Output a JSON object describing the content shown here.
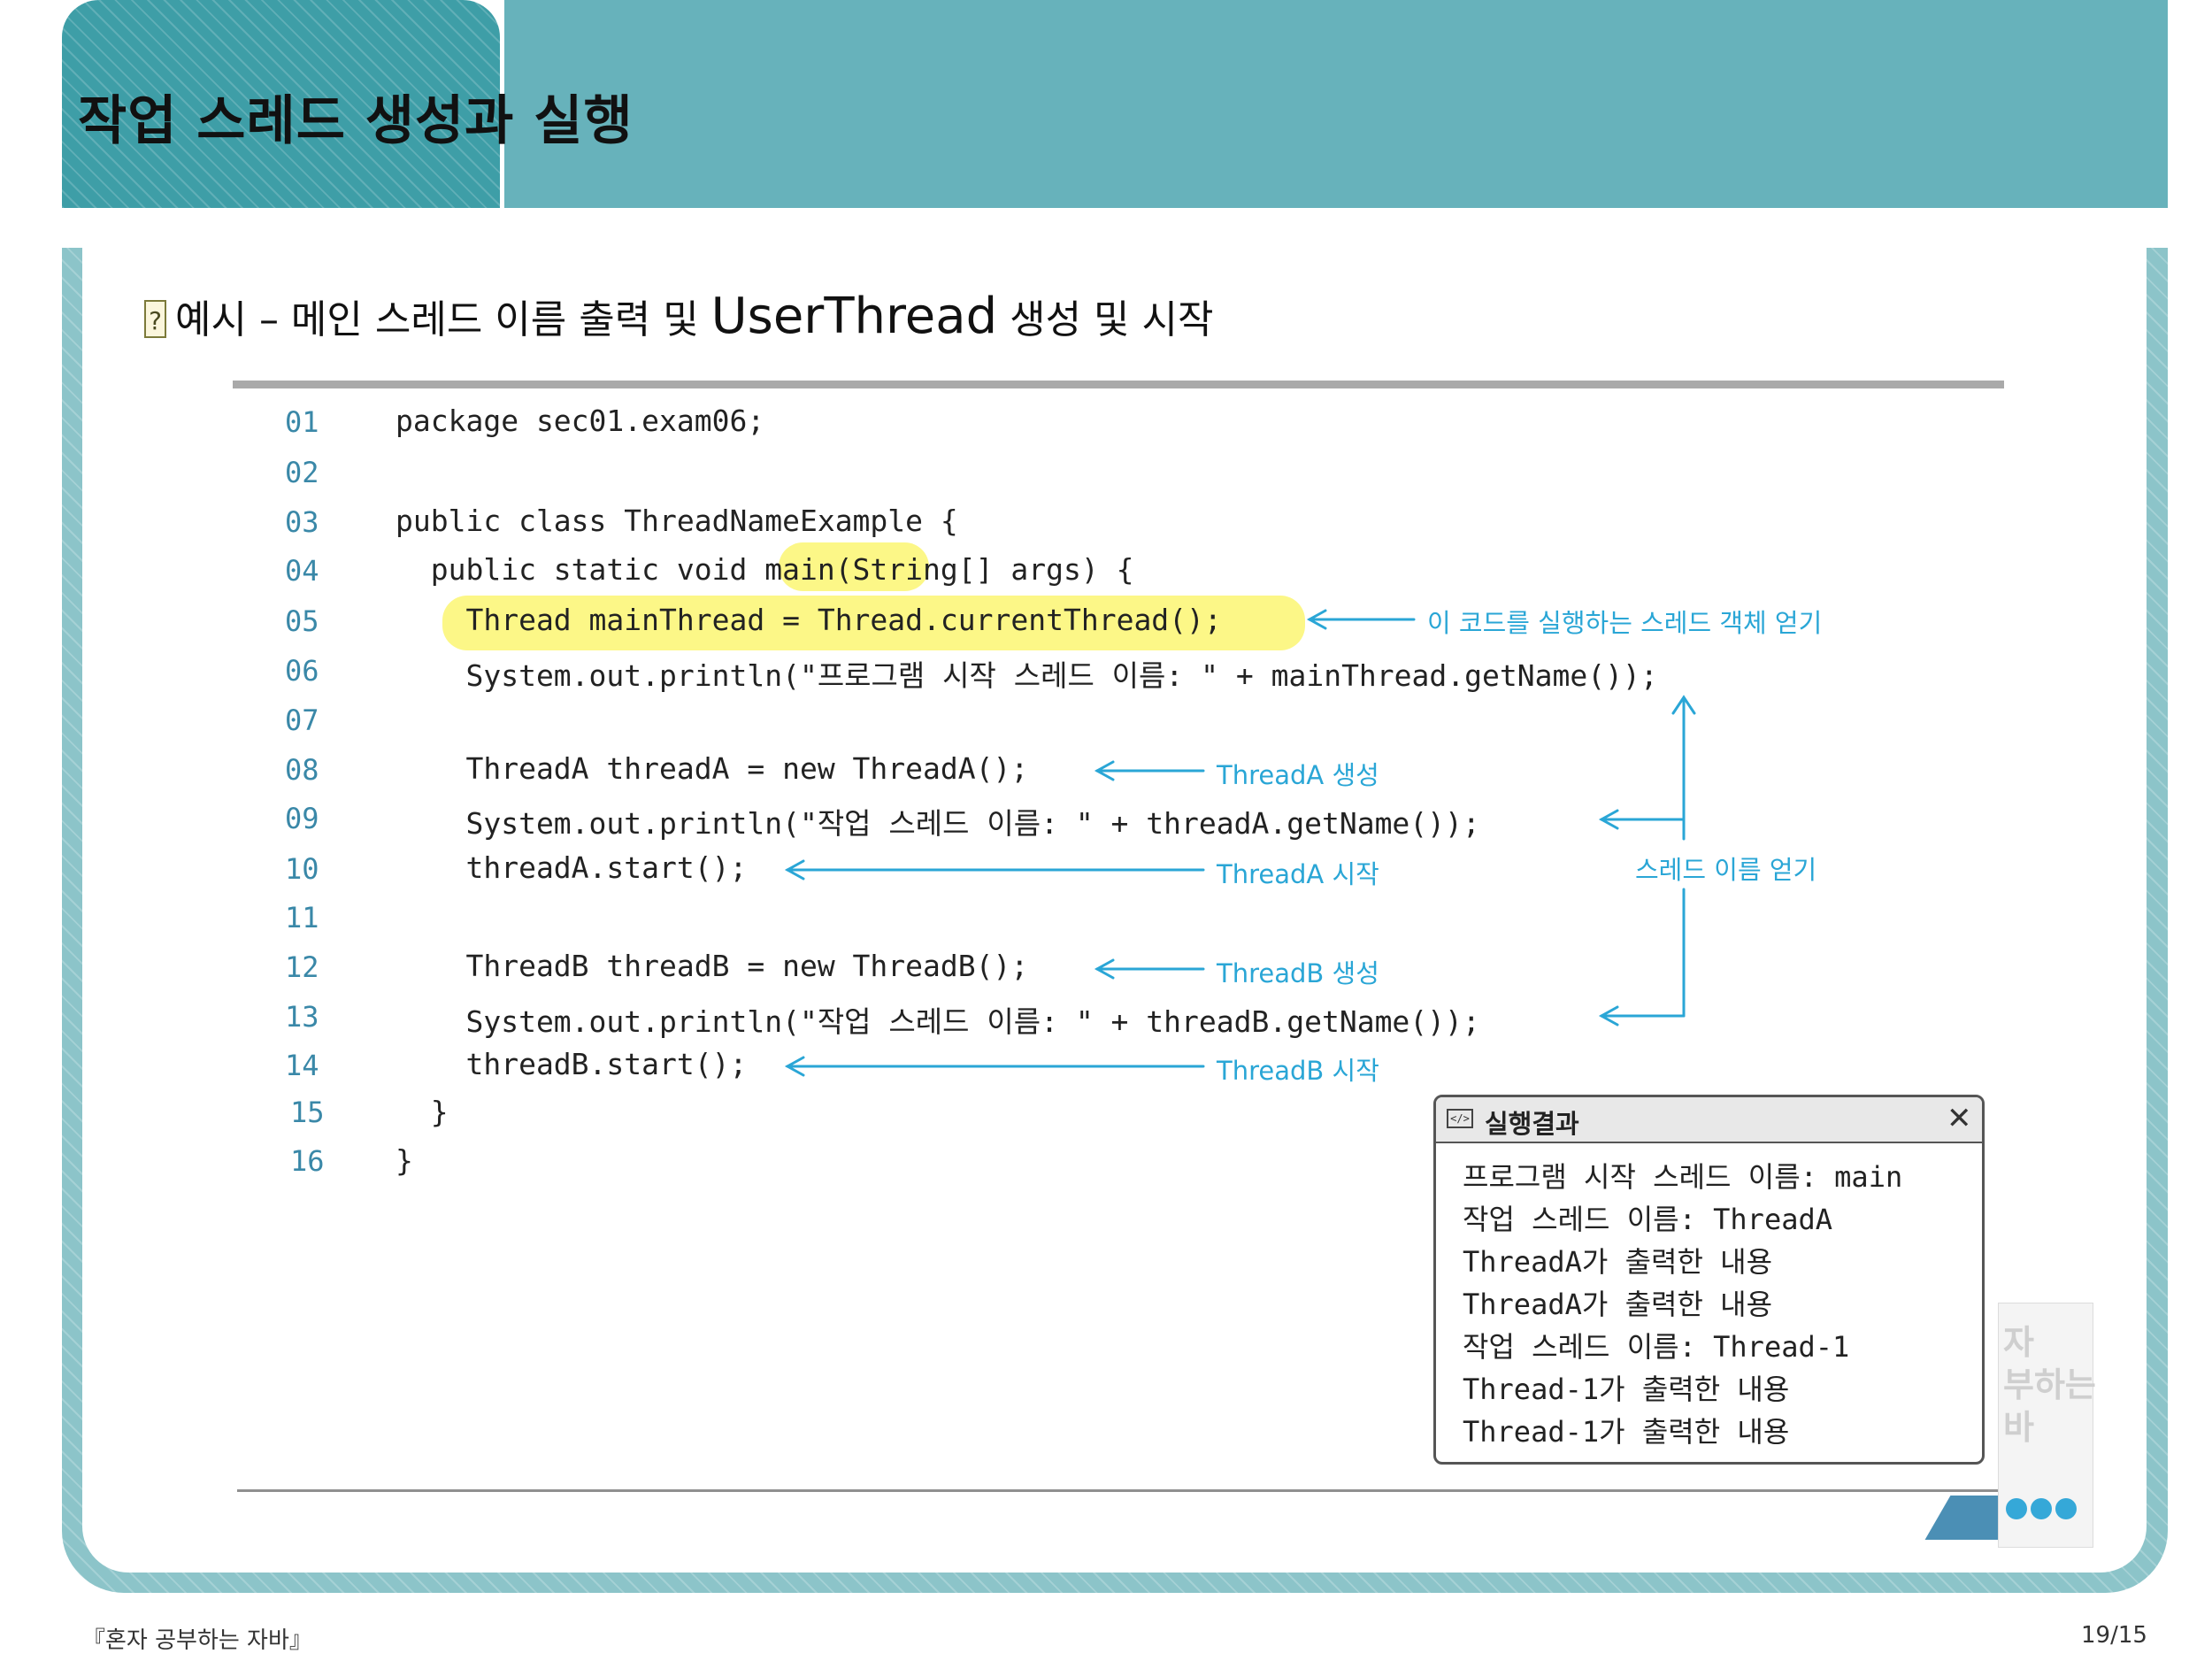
{
  "slide": {
    "title": "작업 스레드 생성과 실행",
    "subtitle_prefix": "예시 – 메인 스레드 이름 출력 및 ",
    "subtitle_code": "UserThread",
    "subtitle_suffix": " 생성 및 시작"
  },
  "code": {
    "line_numbers": [
      "01",
      "02",
      "03",
      "04",
      "05",
      "06",
      "07",
      "08",
      "09",
      "10",
      "11",
      "12",
      "13",
      "14",
      "15",
      "16"
    ],
    "lines": [
      "package sec01.exam06;",
      "",
      "public class ThreadNameExample {",
      "  public static void main(String[] args) {",
      "    Thread mainThread = Thread.currentThread();",
      "    System.out.println(\"프로그램 시작 스레드 이름: \" + mainThread.getName());",
      "",
      "    ThreadA threadA = new ThreadA();",
      "    System.out.println(\"작업 스레드 이름: \" + threadA.getName());",
      "    threadA.start();",
      "",
      "    ThreadB threadB = new ThreadB();",
      "    System.out.println(\"작업 스레드 이름: \" + threadB.getName());",
      "    threadB.start();",
      "  }",
      "}"
    ]
  },
  "annotations": {
    "get_current_thread": "이 코드를 실행하는 스레드 객체 얻기",
    "create_a": "ThreadA 생성",
    "start_a": "ThreadA 시작",
    "create_b": "ThreadB 생성",
    "start_b": "ThreadB 시작",
    "get_name": "스레드 이름 얻기"
  },
  "result": {
    "title": "실행결과",
    "close": "✕",
    "lines": [
      "프로그램 시작 스레드 이름: main",
      "작업 스레드 이름: ThreadA",
      "ThreadA가 출력한 내용",
      "ThreadA가 출력한 내용",
      "작업 스레드 이름: Thread-1",
      "Thread-1가 출력한 내용",
      "Thread-1가 출력한 내용"
    ]
  },
  "book": {
    "title": "자\n부하는\n바"
  },
  "footer": {
    "left": "『혼자 공부하는 자바』",
    "right": "19/15"
  },
  "colors": {
    "header_band": "#67b2bb",
    "header_tab": "#3e9ea7",
    "annotation": "#2aa6d6",
    "highlight": "#fcf787"
  }
}
